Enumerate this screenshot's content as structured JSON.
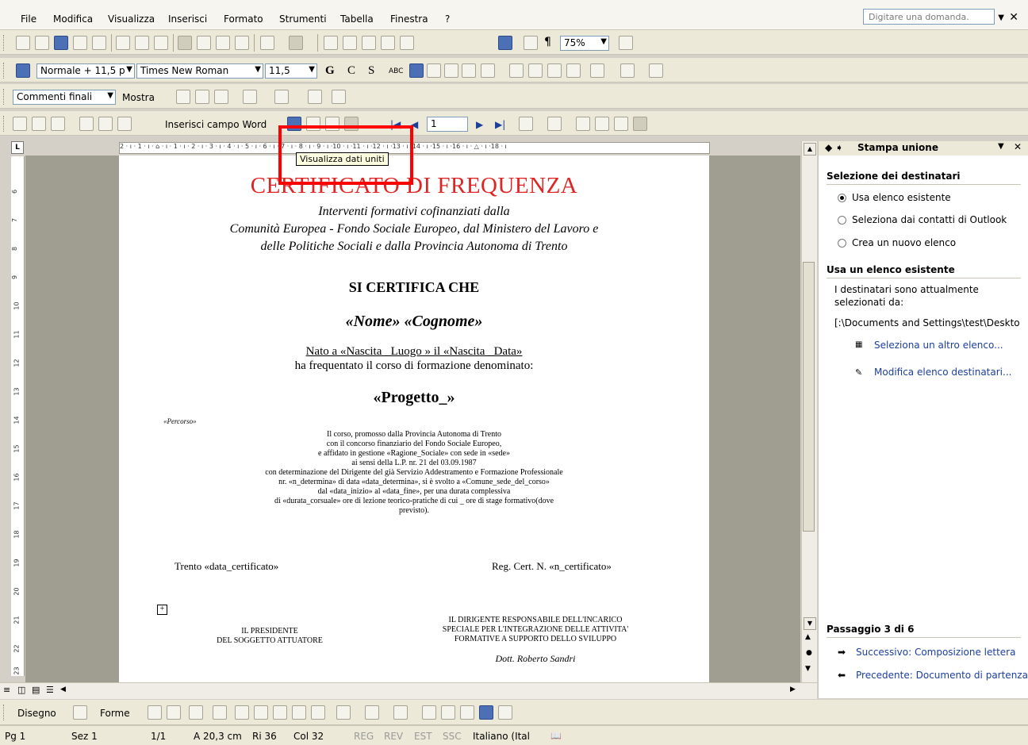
{
  "menu": [
    "File",
    "Modifica",
    "Visualizza",
    "Inserisci",
    "Formato",
    "Strumenti",
    "Tabella",
    "Finestra",
    "?"
  ],
  "ask_placeholder": "Digitare una domanda.",
  "toolbar": {
    "zoom": "75%",
    "style": "Normale + 11,5 p",
    "font": "Times New Roman",
    "size": "11,5",
    "bold": "G",
    "italic": "C",
    "underline": "S",
    "abc": "ABC",
    "pilcrow": "¶",
    "review_display": "Commenti finali",
    "review_show": "Mostra",
    "insert_word_field": "Inserisci campo Word",
    "record_number": "1",
    "draw": "Disegno",
    "shapes": "Forme"
  },
  "tooltip": "Visualizza dati uniti",
  "ruler": "2 · ı · 1 · ı · ⌂ · ı · 1 · ı · 2 · ı · 3 · ı · 4 · ı · 5 · ı · 6 · ı · 7 · ı · 8 · ı · 9 · ı ·10 · ı ·11 · ı ·12 · ı ·13 · ı ·14 · ı ·15 · ı ·16 · ı · △ · ı ·18 · ı",
  "vruler": [
    "6",
    "7",
    "8",
    "9",
    "10",
    "11",
    "12",
    "13",
    "14",
    "15",
    "16",
    "17",
    "18",
    "19",
    "20",
    "21",
    "22",
    "23"
  ],
  "document": {
    "title": "CERTIFICATO DI FREQUENZA",
    "subtitle_lines": [
      "Interventi formativi cofinanziati dalla",
      "Comunità Europea - Fondo Sociale Europeo, dal Ministero del Lavoro e",
      "delle Politiche Sociali e dalla Provincia Autonoma di Trento"
    ],
    "certifies": "SI CERTIFICA CHE",
    "name": "«Nome» «Cognome»",
    "born": "Nato a «Nascita _Luogo » il «Nascita _Data»",
    "attended": "ha frequentato il corso di formazione denominato:",
    "project": "«Progetto_»",
    "route": "«Percorso»",
    "body_lines": [
      "Il corso, promosso dalla Provincia Autonoma di Trento",
      "con il concorso finanziario del Fondo Sociale Europeo,",
      "e affidato in gestione «Ragione_Sociale» con sede in «sede»",
      "ai sensi della L.P. nr. 21 del 03.09.1987",
      "con determinazione del Dirigente del già Servizio Addestramento e Formazione Professionale",
      "nr. «n_determina» di data «data_determina», si è svolto a «Comune_sede_del_corso»",
      "dal «data_inizio» al «data_fine», per una durata complessiva",
      "di «durata_corsuale» ore di lezione teorico-pratiche di cui _ ore di stage formativo(dove",
      "previsto)."
    ],
    "place_date": "Trento «data_certificato»",
    "reg": "Reg. Cert. N. «n_certificato»",
    "president": [
      "IL PRESIDENTE",
      "DEL SOGGETTO ATTUATORE"
    ],
    "director": [
      "IL DIRIGENTE RESPONSABILE DELL'INCARICO",
      "SPECIALE PER L'INTEGRAZIONE DELLE ATTIVITA'",
      "FORMATIVE A SUPPORTO DELLO SVILUPPO"
    ],
    "signature": "Dott. Roberto Sandri"
  },
  "pane": {
    "title": "Stampa unione",
    "section1": "Selezione dei destinatari",
    "options": [
      "Usa elenco esistente",
      "Seleziona dai contatti di Outlook",
      "Crea un nuovo elenco"
    ],
    "selected": 0,
    "section2": "Usa un elenco esistente",
    "info": [
      "I destinatari sono attualmente",
      "selezionati da:"
    ],
    "path": "[:\\Documents and Settings\\test\\Deskto",
    "link1": "Seleziona un altro elenco...",
    "link2": "Modifica elenco destinatari...",
    "step": "Passaggio 3 di 6",
    "next": "Successivo: Composizione lettera",
    "prev": "Precedente: Documento di partenza"
  },
  "status": {
    "page": "Pg 1",
    "section": "Sez 1",
    "pages": "1/1",
    "at": "A 20,3 cm",
    "line": "Ri 36",
    "col": "Col 32",
    "rec": "REG",
    "rev": "REV",
    "ext": "EST",
    "ovr": "SSC",
    "lang": "Italiano (Ital"
  }
}
